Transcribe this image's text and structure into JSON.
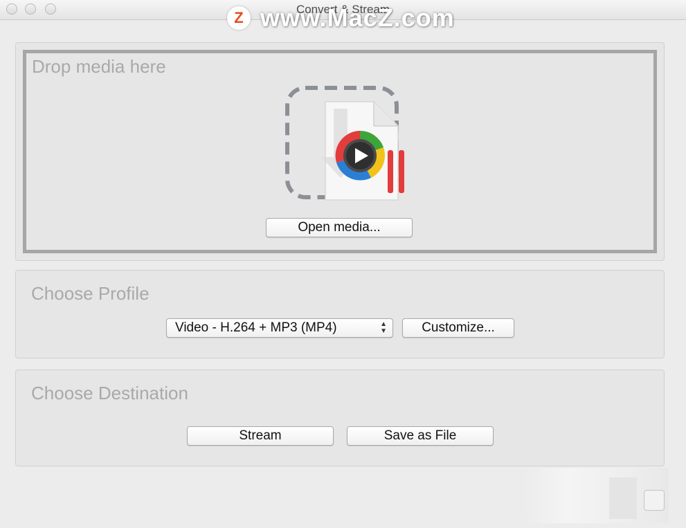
{
  "window": {
    "title": "Convert & Stream",
    "watermark_logo": "Z",
    "watermark_text": "www.MacZ.com"
  },
  "drop_section": {
    "heading": "Drop media here",
    "open_button_label": "Open media...",
    "graphic_icon": "media-file-drop-icon"
  },
  "profile_section": {
    "heading": "Choose Profile",
    "selected_profile": "Video - H.264 + MP3 (MP4)",
    "customize_button_label": "Customize..."
  },
  "destination_section": {
    "heading": "Choose Destination",
    "stream_button_label": "Stream",
    "save_button_label": "Save as File"
  },
  "colors": {
    "window_bg": "#ececec",
    "heading_gray": "#a9a9a9",
    "vlc_accent": "#e23c3c"
  }
}
